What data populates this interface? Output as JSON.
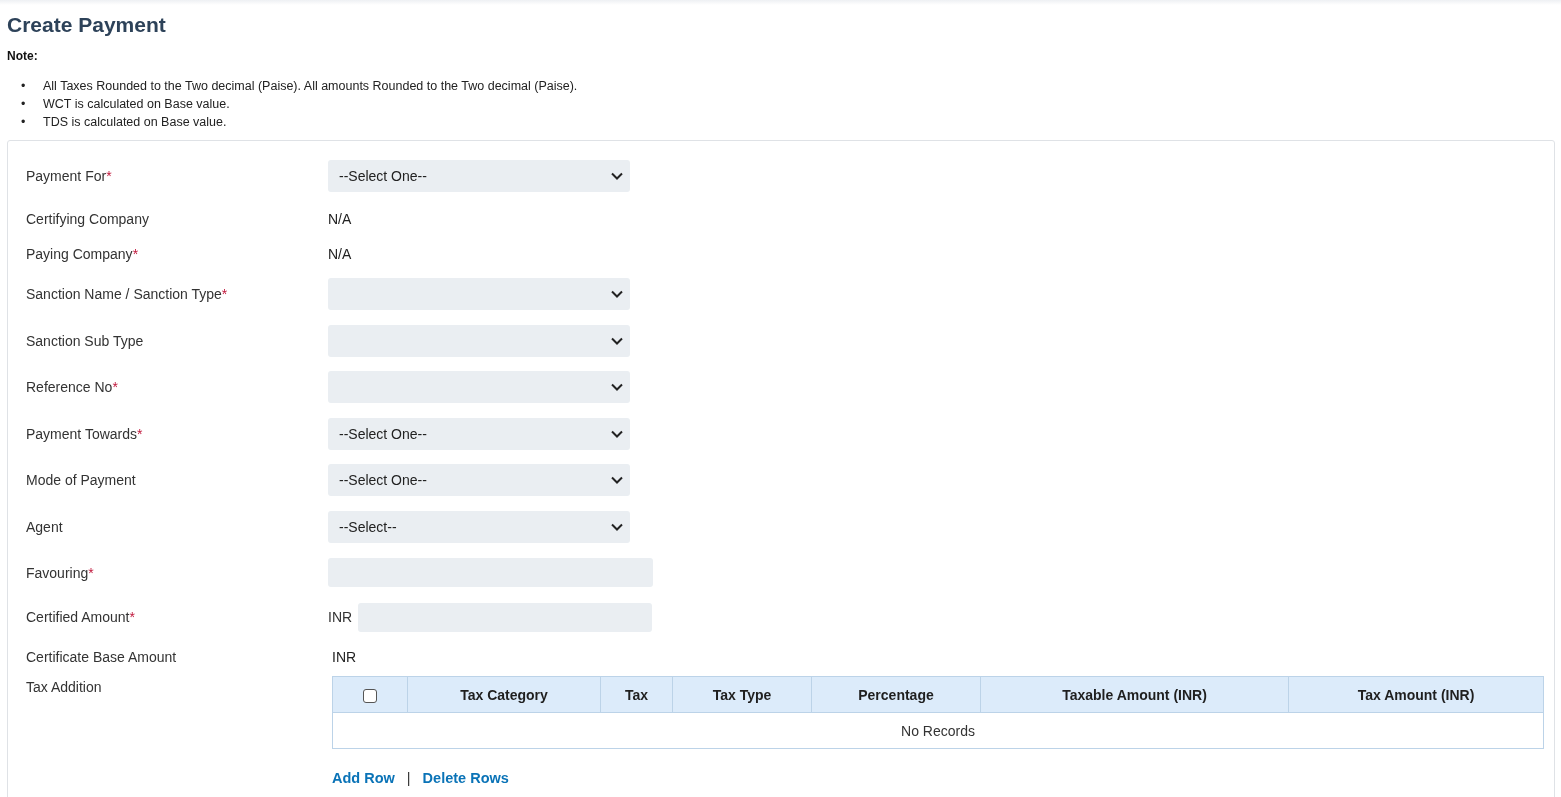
{
  "title": "Create Payment",
  "note": {
    "heading": "Note:",
    "items": [
      {
        "marker": "•",
        "text": "All Taxes Rounded to the Two decimal (Paise). All amounts Rounded to the Two decimal (Paise)."
      },
      {
        "marker": "•",
        "text": "WCT is calculated on Base value."
      },
      {
        "marker": "•",
        "text": "TDS is calculated on Base value."
      }
    ]
  },
  "form": {
    "rows": [
      {
        "kind": "select",
        "label": "Payment For",
        "required_mark": "*",
        "value": "--Select One--"
      },
      {
        "kind": "text",
        "label": "Certifying Company",
        "value": "N/A"
      },
      {
        "kind": "text",
        "label": "Paying Company",
        "required_mark": "*",
        "value": "N/A"
      },
      {
        "kind": "select",
        "label": "Sanction Name / Sanction Type",
        "required_mark": "*"
      },
      {
        "kind": "select",
        "label": "Sanction Sub Type"
      },
      {
        "kind": "select",
        "label": "Reference No",
        "required_mark": "*"
      },
      {
        "kind": "select",
        "label": "Payment Towards",
        "required_mark": "*",
        "value": "--Select One--"
      },
      {
        "kind": "select",
        "label": "Mode of Payment",
        "value": "--Select One--"
      },
      {
        "kind": "select",
        "label": "Agent",
        "value": "--Select--"
      },
      {
        "kind": "input",
        "label": "Favouring",
        "required_mark": "*"
      },
      {
        "kind": "amount",
        "label": "Certified Amount",
        "required_mark": "*",
        "currency": "INR"
      },
      {
        "kind": "text",
        "label": "Certificate Base Amount",
        "value": "INR"
      },
      {
        "kind": "table",
        "label": "Tax Addition"
      }
    ]
  },
  "tax_table": {
    "select_all": {
      "checked": false
    },
    "columns": [
      "Tax Category",
      "Tax",
      "Tax Type",
      "Percentage",
      "Taxable Amount (INR)",
      "Tax Amount (INR)"
    ],
    "empty_text": "No Records"
  },
  "actions": {
    "add": "Add Row",
    "separator": "|",
    "delete": "Delete Rows"
  }
}
